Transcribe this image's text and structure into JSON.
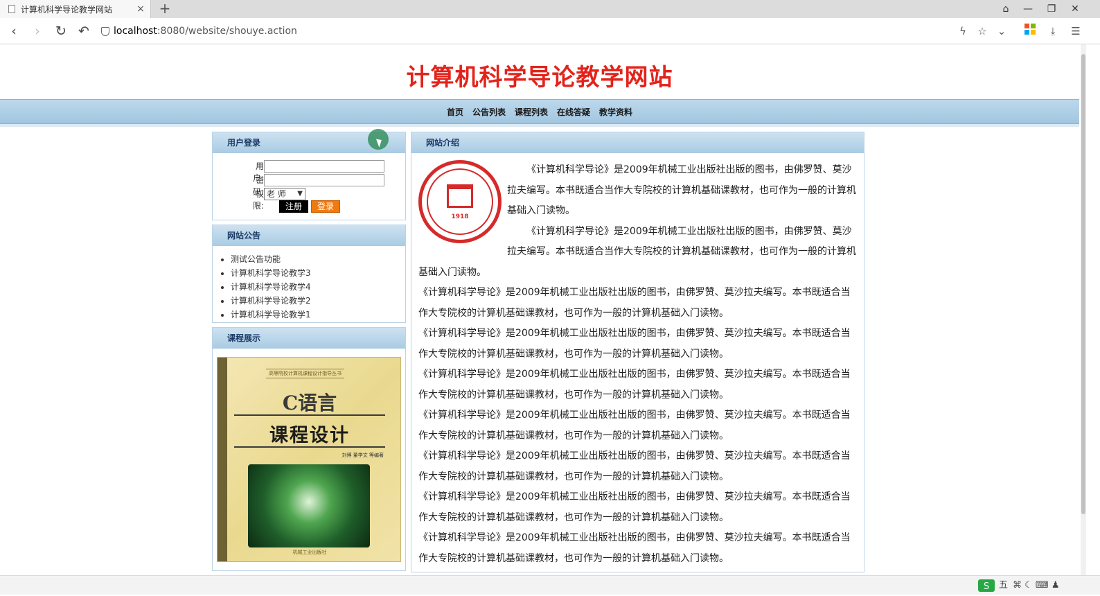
{
  "browser": {
    "tab_title": "计算机科学导论教学网站",
    "tab_close": "×",
    "new_tab": "+",
    "url_host": "localhost",
    "url_rest": ":8080/website/shouye.action",
    "nav": {
      "back": "‹",
      "forward": "›",
      "reload": "↻",
      "undo": "↶"
    },
    "right_icons": {
      "lightning": "ϟ",
      "star": "☆",
      "chevron": "⌄",
      "download": "⤓",
      "menu": "☰"
    },
    "window": {
      "shirt": "⌂",
      "minimize": "—",
      "restore": "❐",
      "close": "✕"
    }
  },
  "site": {
    "title": "计算机科学导论教学网站",
    "nav": [
      "首页",
      "公告列表",
      "课程列表",
      "在线答疑",
      "教学资料"
    ]
  },
  "login": {
    "header": "用户登录",
    "user_label": "用户:",
    "password_label": "密码:",
    "role_label": "权限:",
    "role_value": "老 师",
    "register_label": "注册",
    "login_label": "登录"
  },
  "notices": {
    "header": "网站公告",
    "items": [
      "测试公告功能",
      "计算机科学导论教学3",
      "计算机科学导论教学4",
      "计算机科学导论教学2",
      "计算机科学导论教学1"
    ]
  },
  "courses": {
    "header": "课程展示",
    "cover": {
      "series": "高等院校计算机课程设计指导丛书",
      "title_line1": "C语言",
      "title_line2": "课程设计",
      "authors": "刘博 董学文 等编著",
      "publisher": "机械工业出版社"
    }
  },
  "intro": {
    "header": "网站介绍",
    "paragraphs": [
      "《计算机科学导论》是2009年机械工业出版社出版的图书，由佛罗赞、莫沙拉夫编写。本书既适合当作大专院校的计算机基础课教材，也可作为一般的计算机基础入门读物。",
      "《计算机科学导论》是2009年机械工业出版社出版的图书，由佛罗赞、莫沙拉夫编写。本书既适合当作大专院校的计算机基础课教材，也可作为一般的计算机基础入门读物。",
      "《计算机科学导论》是2009年机械工业出版社出版的图书，由佛罗赞、莫沙拉夫编写。本书既适合当作大专院校的计算机基础课教材，也可作为一般的计算机基础入门读物。",
      "《计算机科学导论》是2009年机械工业出版社出版的图书，由佛罗赞、莫沙拉夫编写。本书既适合当作大专院校的计算机基础课教材，也可作为一般的计算机基础入门读物。",
      "《计算机科学导论》是2009年机械工业出版社出版的图书，由佛罗赞、莫沙拉夫编写。本书既适合当作大专院校的计算机基础课教材，也可作为一般的计算机基础入门读物。",
      "《计算机科学导论》是2009年机械工业出版社出版的图书，由佛罗赞、莫沙拉夫编写。本书既适合当作大专院校的计算机基础课教材，也可作为一般的计算机基础入门读物。",
      "《计算机科学导论》是2009年机械工业出版社出版的图书，由佛罗赞、莫沙拉夫编写。本书既适合当作大专院校的计算机基础课教材，也可作为一般的计算机基础入门读物。",
      "《计算机科学导论》是2009年机械工业出版社出版的图书，由佛罗赞、莫沙拉夫编写。本书既适合当作大专院校的计算机基础课教材，也可作为一般的计算机基础入门读物。",
      "《计算机科学导论》是2009年机械工业出版社出版的图书，由佛罗赞、莫沙拉夫编写。本书既适合当作大专院校的计算机基础课教材，也可作为一般的计算机基础入门读物。"
    ],
    "seal_logo": {
      "year": "1918",
      "name": "JIMEI UNIVERSITY",
      "chinese": "集美大学",
      "motto": "诚毅"
    }
  },
  "tray": {
    "ime": "五",
    "icons": "⌘ ☾ ⌨ ♟"
  }
}
